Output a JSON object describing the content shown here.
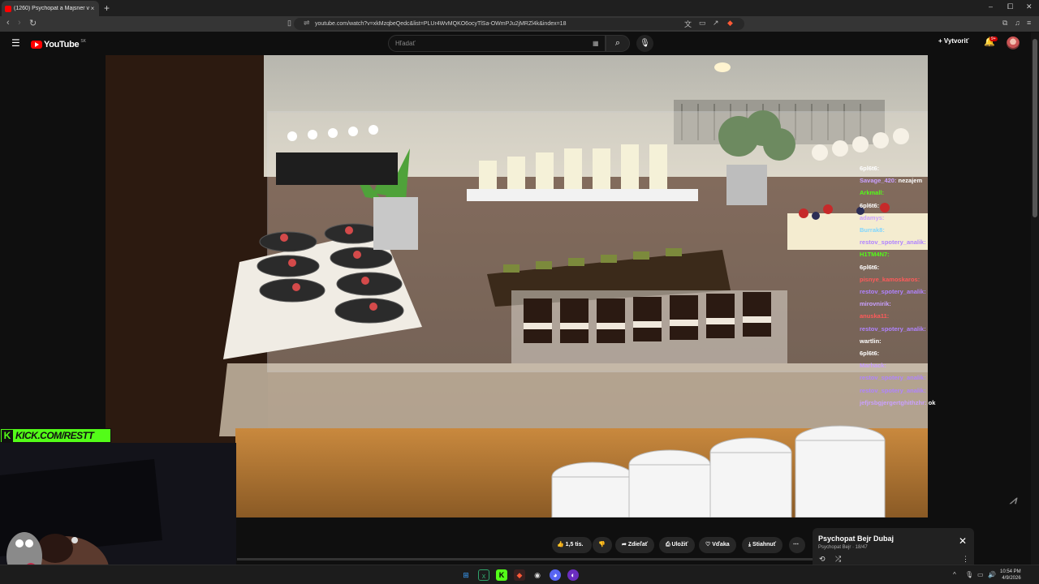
{
  "browser": {
    "tab_title": "(1260) Psychopat a Majsner v",
    "new_tab": "+",
    "url": "youtube.com/watch?v=xkMzqbeQedc&list=PLUr4WvMQKO6ocyTlSa-OWmPJu2jMRZl4k&index=18",
    "controls": {
      "minimize": "–",
      "maximize": "⧠",
      "close": "✕"
    }
  },
  "youtube": {
    "logo_text": "YouTube",
    "country_code": "SK",
    "search_placeholder": "Hľadať",
    "create_label": "Vytvoriť",
    "notification_count": "9+"
  },
  "overlay": {
    "kick_label": "KICK.COM/RESTT",
    "chat": [
      {
        "user": "6pl6t6:",
        "msg": "",
        "color": "#ffffff"
      },
      {
        "user": "Savage_420:",
        "msg": "nezajem",
        "color": "#c9a0ff"
      },
      {
        "user": "Arkmall:",
        "msg": "",
        "color": "#53fc18"
      },
      {
        "user": "6pl6t6:",
        "msg": "",
        "color": "#ffffff"
      },
      {
        "user": "adamys:",
        "msg": "",
        "color": "#c9a0ff"
      },
      {
        "user": "Burrak8:",
        "msg": "",
        "color": "#7fd6ff"
      },
      {
        "user": "restov_spotery_analik:",
        "msg": "",
        "color": "#b083ff"
      },
      {
        "user": "H1TM4N7:",
        "msg": "",
        "color": "#53fc18"
      },
      {
        "user": "6pl6t6:",
        "msg": "",
        "color": "#ffffff"
      },
      {
        "user": "pisnye_kamoskaros:",
        "msg": "",
        "color": "#ff5a5a"
      },
      {
        "user": "restov_spotery_analik:",
        "msg": "",
        "color": "#b083ff"
      },
      {
        "user": "mirovnirik:",
        "msg": "",
        "color": "#c9a0ff"
      },
      {
        "user": "anuska11:",
        "msg": "",
        "color": "#ff5a5a"
      },
      {
        "user": "restov_spotery_analik:",
        "msg": "",
        "color": "#b083ff"
      },
      {
        "user": "wartlin:",
        "msg": "",
        "color": "#ffffff"
      },
      {
        "user": "6pl6t6:",
        "msg": "",
        "color": "#ffffff"
      },
      {
        "user": "Marhack:",
        "msg": "",
        "color": "#c9a0ff"
      },
      {
        "user": "restov_spotery_analik:",
        "msg": "",
        "color": "#b083ff"
      },
      {
        "user": "restov_spotery_analik:",
        "msg": "",
        "color": "#b083ff"
      },
      {
        "user": "jefjrsbgjergertghithzhr:",
        "msg": "ok",
        "color": "#c9a0ff"
      }
    ]
  },
  "actions": {
    "like_count": "1,5 tis.",
    "share": "Zdieľať",
    "save": "Uložiť",
    "thanks": "Vďaka",
    "download": "Stiahnuť",
    "more": "⋯"
  },
  "miniplayer": {
    "title": "Psychopat Bejr  Dubaj",
    "subtitle": "Psychopat Bejr · 18/47"
  },
  "taskbar": {
    "time": "10:54 PM",
    "date": "4/9/2026"
  },
  "colors": {
    "youtube_red": "#ff0000",
    "kick_green": "#53fc18",
    "background": "#0f0f0f"
  }
}
